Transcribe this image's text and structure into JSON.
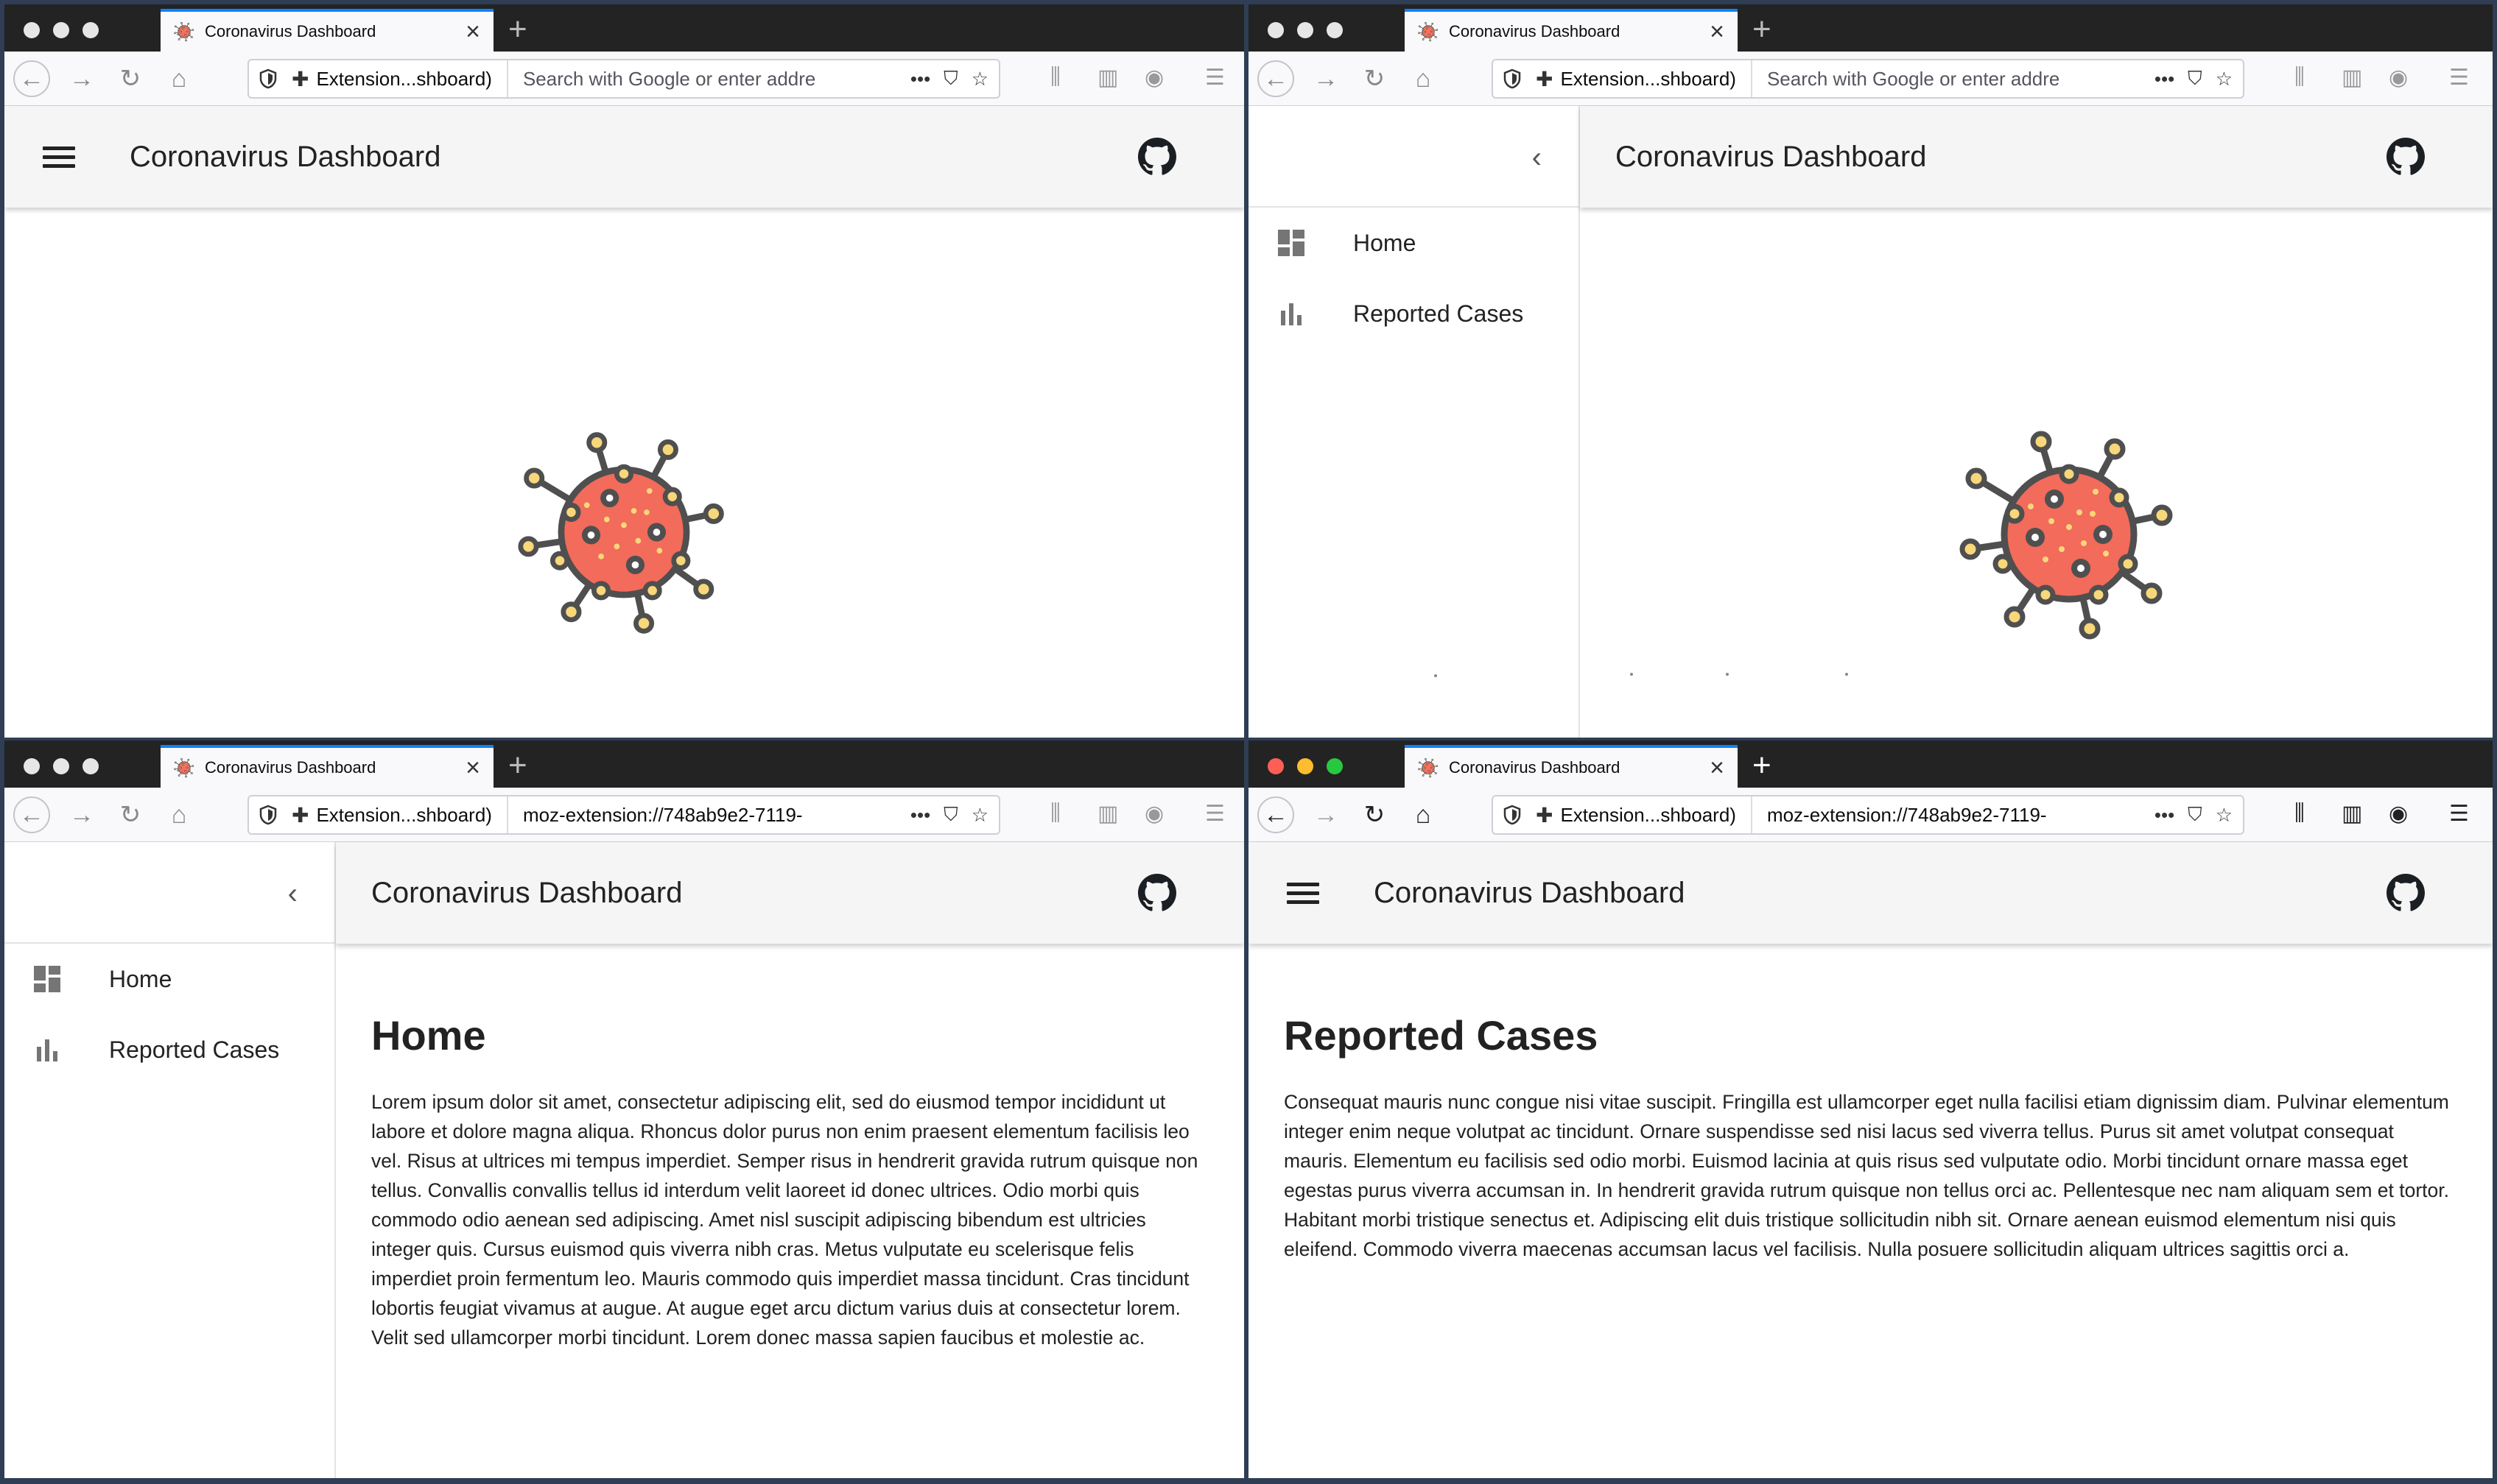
{
  "browser": {
    "tab_title": "Coronavirus Dashboard",
    "ext_label": "Extension...shboard)",
    "url_placeholder": "Search with Google or enter addre",
    "url_value": "moz-extension://748ab9e2-7119-"
  },
  "app": {
    "title": "Coronavirus Dashboard"
  },
  "drawer": {
    "items": [
      {
        "label": "Home",
        "icon": "dashboard-icon"
      },
      {
        "label": "Reported Cases",
        "icon": "bar-chart-icon"
      }
    ]
  },
  "home": {
    "heading": "Home",
    "body": "Lorem ipsum dolor sit amet, consectetur adipiscing elit, sed do eiusmod tempor incididunt ut labore et dolore magna aliqua. Rhoncus dolor purus non enim praesent elementum facilisis leo vel. Risus at ultrices mi tempus imperdiet. Semper risus in hendrerit gravida rutrum quisque non tellus. Convallis convallis tellus id interdum velit laoreet id donec ultrices. Odio morbi quis commodo odio aenean sed adipiscing. Amet nisl suscipit adipiscing bibendum est ultricies integer quis. Cursus euismod quis viverra nibh cras. Metus vulputate eu scelerisque felis imperdiet proin fermentum leo. Mauris commodo quis imperdiet massa tincidunt. Cras tincidunt lobortis feugiat vivamus at augue. At augue eget arcu dictum varius duis at consectetur lorem. Velit sed ullamcorper morbi tincidunt. Lorem donec massa sapien faucibus et molestie ac."
  },
  "reported": {
    "heading": "Reported Cases",
    "body": "Consequat mauris nunc congue nisi vitae suscipit. Fringilla est ullamcorper eget nulla facilisi etiam dignissim diam. Pulvinar elementum integer enim neque volutpat ac tincidunt. Ornare suspendisse sed nisi lacus sed viverra tellus. Purus sit amet volutpat consequat mauris. Elementum eu facilisis sed odio morbi. Euismod lacinia at quis risus sed vulputate odio. Morbi tincidunt ornare massa eget egestas purus viverra accumsan in. In hendrerit gravida rutrum quisque non tellus orci ac. Pellentesque nec nam aliquam sem et tortor. Habitant morbi tristique senectus et. Adipiscing elit duis tristique sollicitudin nibh sit. Ornare aenean euismod elementum nisi quis eleifend. Commodo viverra maecenas accumsan lacus vel facilisis. Nulla posuere sollicitudin aliquam ultrices sagittis orci a."
  },
  "colors": {
    "virus_body": "#f26b5b",
    "virus_stroke": "#4f4f4f",
    "virus_spot": "#f7d77a",
    "tab_accent": "#0a84ff"
  }
}
